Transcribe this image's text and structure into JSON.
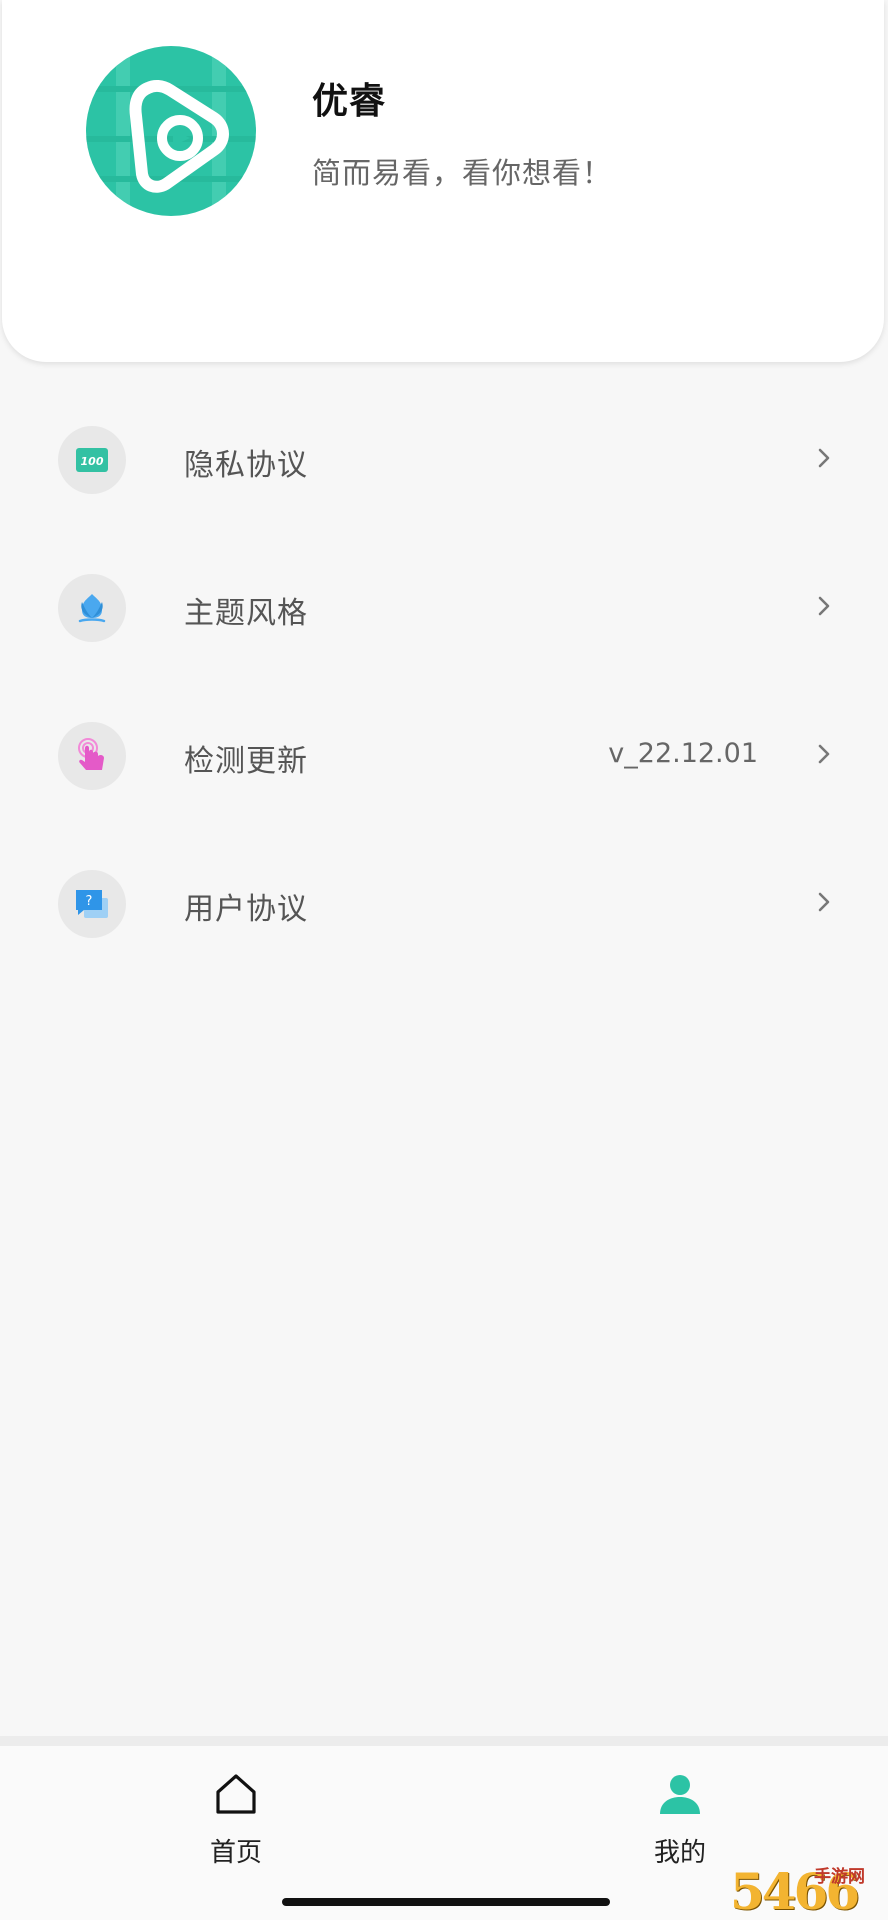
{
  "app": {
    "name": "优睿",
    "slogan": "简而易看，看你想看！",
    "logo_icon": "video-play-logo-icon",
    "accent_color": "#2cc3a5"
  },
  "menu": {
    "items": [
      {
        "label": "隐私协议",
        "icon": "score-100-icon",
        "value": ""
      },
      {
        "label": "主题风格",
        "icon": "tulip-icon",
        "value": ""
      },
      {
        "label": "检测更新",
        "icon": "tap-hand-icon",
        "value": "v_22.12.01"
      },
      {
        "label": "用户协议",
        "icon": "question-chat-icon",
        "value": ""
      }
    ]
  },
  "bottom_nav": {
    "tabs": [
      {
        "label": "首页",
        "icon": "home-icon",
        "active": false
      },
      {
        "label": "我的",
        "icon": "user-icon",
        "active": true
      }
    ]
  },
  "watermark": {
    "number": "5466",
    "text": "手游网"
  }
}
